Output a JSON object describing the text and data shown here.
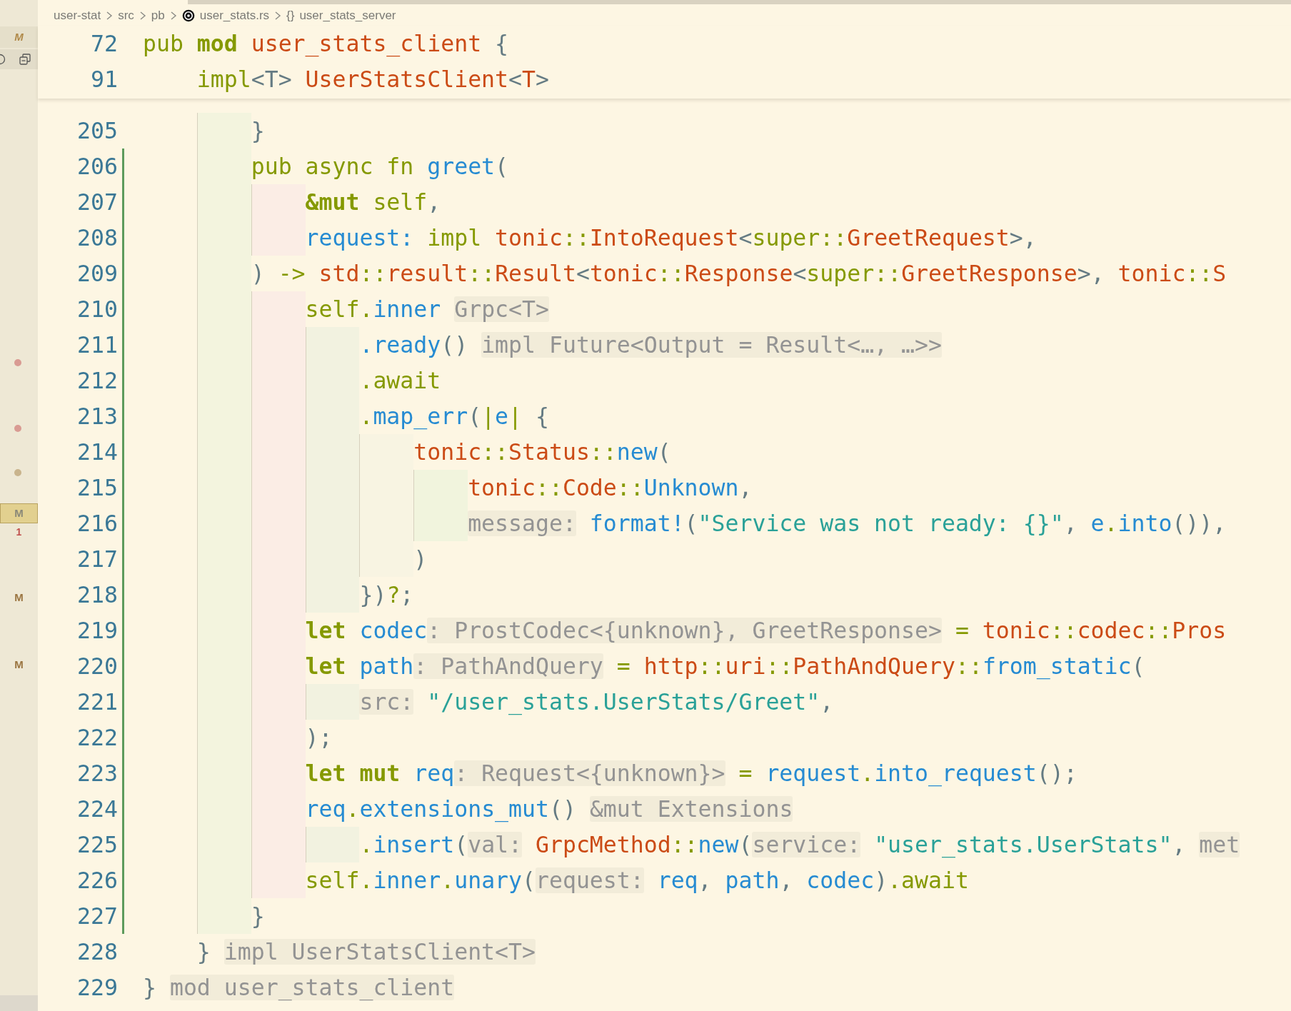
{
  "breadcrumb": [
    {
      "kind": "folder",
      "label": "user-stat"
    },
    {
      "kind": "folder",
      "label": "src"
    },
    {
      "kind": "folder",
      "label": "pb"
    },
    {
      "kind": "file",
      "label": "user_stats.rs"
    },
    {
      "kind": "module",
      "glyph": "{}",
      "label": "user_stats_server"
    }
  ],
  "side_strip": [
    {
      "kind": "heading-letter",
      "text": "M"
    },
    {
      "kind": "icons"
    },
    {
      "kind": "dot",
      "color": "#d99b93"
    },
    {
      "kind": "dot",
      "color": "#d99b93"
    },
    {
      "kind": "dot",
      "color": "#c9b48d"
    },
    {
      "kind": "letter",
      "text": "M",
      "selected": true
    },
    {
      "kind": "count",
      "text": "1"
    },
    {
      "kind": "letter",
      "text": "M",
      "selected": false
    },
    {
      "kind": "letter",
      "text": "M",
      "selected": false
    }
  ],
  "sticky_scroll": [
    {
      "number": "72",
      "tokens": [
        {
          "kind": "keyword",
          "text": "pub "
        },
        {
          "kind": "bold",
          "text": "mod "
        },
        {
          "kind": "type",
          "text": "user_stats_client"
        },
        {
          "kind": "punct",
          "text": " {"
        }
      ]
    },
    {
      "number": "91",
      "tokens": [
        {
          "kind": "keyword",
          "text": "    impl"
        },
        {
          "kind": "punct",
          "text": "<T> "
        },
        {
          "kind": "type",
          "text": "UserStatsClient"
        },
        {
          "kind": "punct",
          "text": "<"
        },
        {
          "kind": "type",
          "text": "T"
        },
        {
          "kind": "punct",
          "text": ">"
        }
      ]
    }
  ],
  "lines": [
    {
      "number": "205",
      "modified": false,
      "tokens": [
        {
          "kind": "punct",
          "text": "        }"
        }
      ]
    },
    {
      "number": "206",
      "modified": true,
      "tokens": [
        {
          "kind": "keyword",
          "text": "        pub async fn "
        },
        {
          "kind": "ident",
          "text": "greet"
        },
        {
          "kind": "punct",
          "text": "("
        }
      ]
    },
    {
      "number": "207",
      "modified": true,
      "tokens": [
        {
          "kind": "bold",
          "text": "            &mut "
        },
        {
          "kind": "keyword",
          "text": "self"
        },
        {
          "kind": "punct",
          "text": ","
        }
      ]
    },
    {
      "number": "208",
      "modified": true,
      "tokens": [
        {
          "kind": "ident",
          "text": "            request: "
        },
        {
          "kind": "keyword",
          "text": "impl "
        },
        {
          "kind": "type",
          "text": "tonic"
        },
        {
          "kind": "keyword",
          "text": "::"
        },
        {
          "kind": "type",
          "text": "IntoRequest"
        },
        {
          "kind": "punct",
          "text": "<"
        },
        {
          "kind": "keyword",
          "text": "super::"
        },
        {
          "kind": "type",
          "text": "GreetRequest"
        },
        {
          "kind": "punct",
          "text": ">,"
        }
      ]
    },
    {
      "number": "209",
      "modified": true,
      "tokens": [
        {
          "kind": "punct",
          "text": "        ) "
        },
        {
          "kind": "keyword",
          "text": "-> "
        },
        {
          "kind": "type",
          "text": "std"
        },
        {
          "kind": "keyword",
          "text": "::"
        },
        {
          "kind": "type",
          "text": "result"
        },
        {
          "kind": "keyword",
          "text": "::"
        },
        {
          "kind": "type",
          "text": "Result"
        },
        {
          "kind": "punct",
          "text": "<"
        },
        {
          "kind": "type",
          "text": "tonic"
        },
        {
          "kind": "keyword",
          "text": "::"
        },
        {
          "kind": "type",
          "text": "Response"
        },
        {
          "kind": "punct",
          "text": "<"
        },
        {
          "kind": "keyword",
          "text": "super::"
        },
        {
          "kind": "type",
          "text": "GreetResponse"
        },
        {
          "kind": "punct",
          "text": ">, "
        },
        {
          "kind": "type",
          "text": "tonic"
        },
        {
          "kind": "keyword",
          "text": "::"
        },
        {
          "kind": "type",
          "text": "S"
        }
      ]
    },
    {
      "number": "210",
      "modified": true,
      "tokens": [
        {
          "kind": "keyword",
          "text": "            self."
        },
        {
          "kind": "ident",
          "text": "inner "
        },
        {
          "kind": "hint",
          "text": "Grpc<T>"
        }
      ]
    },
    {
      "number": "211",
      "modified": true,
      "tokens": [
        {
          "kind": "ident",
          "text": "                .ready"
        },
        {
          "kind": "punct",
          "text": "() "
        },
        {
          "kind": "hint",
          "text": "impl Future<Output = Result<…, …>>"
        }
      ]
    },
    {
      "number": "212",
      "modified": true,
      "tokens": [
        {
          "kind": "keyword",
          "text": "                .await"
        }
      ]
    },
    {
      "number": "213",
      "modified": true,
      "tokens": [
        {
          "kind": "keyword",
          "text": "                ."
        },
        {
          "kind": "ident",
          "text": "map_err"
        },
        {
          "kind": "punct",
          "text": "("
        },
        {
          "kind": "keyword",
          "text": "|"
        },
        {
          "kind": "ident",
          "text": "e"
        },
        {
          "kind": "keyword",
          "text": "| "
        },
        {
          "kind": "punct",
          "text": "{"
        }
      ]
    },
    {
      "number": "214",
      "modified": true,
      "tokens": [
        {
          "kind": "type",
          "text": "                    tonic"
        },
        {
          "kind": "keyword",
          "text": "::"
        },
        {
          "kind": "type",
          "text": "Status"
        },
        {
          "kind": "keyword",
          "text": "::"
        },
        {
          "kind": "ident",
          "text": "new"
        },
        {
          "kind": "punct",
          "text": "("
        }
      ]
    },
    {
      "number": "215",
      "modified": true,
      "tokens": [
        {
          "kind": "type",
          "text": "                        tonic"
        },
        {
          "kind": "keyword",
          "text": "::"
        },
        {
          "kind": "type",
          "text": "Code"
        },
        {
          "kind": "keyword",
          "text": "::"
        },
        {
          "kind": "ident",
          "text": "Unknown"
        },
        {
          "kind": "punct",
          "text": ","
        }
      ]
    },
    {
      "number": "216",
      "modified": true,
      "tokens": [
        {
          "kind": "hint",
          "text": "                        message:"
        },
        {
          "kind": "ident",
          "text": " format!"
        },
        {
          "kind": "punct",
          "text": "("
        },
        {
          "kind": "string",
          "text": "\"Service was not ready: {}\""
        },
        {
          "kind": "punct",
          "text": ", "
        },
        {
          "kind": "ident",
          "text": "e"
        },
        {
          "kind": "keyword",
          "text": "."
        },
        {
          "kind": "ident",
          "text": "into"
        },
        {
          "kind": "punct",
          "text": "()),"
        }
      ]
    },
    {
      "number": "217",
      "modified": true,
      "tokens": [
        {
          "kind": "punct",
          "text": "                    )"
        }
      ]
    },
    {
      "number": "218",
      "modified": true,
      "tokens": [
        {
          "kind": "punct",
          "text": "                })"
        },
        {
          "kind": "keyword",
          "text": "?"
        },
        {
          "kind": "punct",
          "text": ";"
        }
      ]
    },
    {
      "number": "219",
      "modified": true,
      "tokens": [
        {
          "kind": "bold",
          "text": "            let "
        },
        {
          "kind": "ident",
          "text": "codec"
        },
        {
          "kind": "hint",
          "text": ": ProstCodec<{unknown}, GreetResponse>"
        },
        {
          "kind": "keyword",
          "text": " = "
        },
        {
          "kind": "type",
          "text": "tonic"
        },
        {
          "kind": "keyword",
          "text": "::"
        },
        {
          "kind": "type",
          "text": "codec"
        },
        {
          "kind": "keyword",
          "text": "::"
        },
        {
          "kind": "type",
          "text": "Pros"
        }
      ]
    },
    {
      "number": "220",
      "modified": true,
      "tokens": [
        {
          "kind": "bold",
          "text": "            let "
        },
        {
          "kind": "ident",
          "text": "path"
        },
        {
          "kind": "hint",
          "text": ": PathAndQuery"
        },
        {
          "kind": "keyword",
          "text": " = "
        },
        {
          "kind": "type",
          "text": "http"
        },
        {
          "kind": "keyword",
          "text": "::"
        },
        {
          "kind": "type",
          "text": "uri"
        },
        {
          "kind": "keyword",
          "text": "::"
        },
        {
          "kind": "type",
          "text": "PathAndQuery"
        },
        {
          "kind": "keyword",
          "text": "::"
        },
        {
          "kind": "ident",
          "text": "from_static"
        },
        {
          "kind": "punct",
          "text": "("
        }
      ]
    },
    {
      "number": "221",
      "modified": true,
      "tokens": [
        {
          "kind": "hint",
          "text": "                src:"
        },
        {
          "kind": "string",
          "text": " \"/user_stats.UserStats/Greet\""
        },
        {
          "kind": "punct",
          "text": ","
        }
      ]
    },
    {
      "number": "222",
      "modified": true,
      "tokens": [
        {
          "kind": "punct",
          "text": "            );"
        }
      ]
    },
    {
      "number": "223",
      "modified": true,
      "tokens": [
        {
          "kind": "bold",
          "text": "            let mut "
        },
        {
          "kind": "ident",
          "text": "req"
        },
        {
          "kind": "hint",
          "text": ": Request<{unknown}>"
        },
        {
          "kind": "keyword",
          "text": " = "
        },
        {
          "kind": "ident",
          "text": "request"
        },
        {
          "kind": "keyword",
          "text": "."
        },
        {
          "kind": "ident",
          "text": "into_request"
        },
        {
          "kind": "punct",
          "text": "();"
        }
      ]
    },
    {
      "number": "224",
      "modified": true,
      "tokens": [
        {
          "kind": "ident",
          "text": "            req"
        },
        {
          "kind": "keyword",
          "text": "."
        },
        {
          "kind": "ident",
          "text": "extensions_mut"
        },
        {
          "kind": "punct",
          "text": "() "
        },
        {
          "kind": "hint",
          "text": "&mut Extensions"
        }
      ]
    },
    {
      "number": "225",
      "modified": true,
      "tokens": [
        {
          "kind": "keyword",
          "text": "                ."
        },
        {
          "kind": "ident",
          "text": "insert"
        },
        {
          "kind": "punct",
          "text": "("
        },
        {
          "kind": "hint",
          "text": "val:"
        },
        {
          "kind": "type",
          "text": " GrpcMethod"
        },
        {
          "kind": "keyword",
          "text": "::"
        },
        {
          "kind": "ident",
          "text": "new"
        },
        {
          "kind": "punct",
          "text": "("
        },
        {
          "kind": "hint",
          "text": "service:"
        },
        {
          "kind": "string",
          "text": " \"user_stats.UserStats\""
        },
        {
          "kind": "punct",
          "text": ", "
        },
        {
          "kind": "hint",
          "text": "met"
        }
      ]
    },
    {
      "number": "226",
      "modified": true,
      "tokens": [
        {
          "kind": "keyword",
          "text": "            self."
        },
        {
          "kind": "ident",
          "text": "inner"
        },
        {
          "kind": "keyword",
          "text": "."
        },
        {
          "kind": "ident",
          "text": "unary"
        },
        {
          "kind": "punct",
          "text": "("
        },
        {
          "kind": "hint",
          "text": "request:"
        },
        {
          "kind": "ident",
          "text": " req"
        },
        {
          "kind": "punct",
          "text": ", "
        },
        {
          "kind": "ident",
          "text": "path"
        },
        {
          "kind": "punct",
          "text": ", "
        },
        {
          "kind": "ident",
          "text": "codec"
        },
        {
          "kind": "punct",
          "text": ")"
        },
        {
          "kind": "keyword",
          "text": ".await"
        }
      ]
    },
    {
      "number": "227",
      "modified": true,
      "tokens": [
        {
          "kind": "punct",
          "text": "        }"
        }
      ]
    },
    {
      "number": "228",
      "modified": false,
      "tokens": [
        {
          "kind": "punct",
          "text": "    } "
        },
        {
          "kind": "hint",
          "text": "impl UserStatsClient<T>"
        }
      ]
    },
    {
      "number": "229",
      "modified": false,
      "tokens": [
        {
          "kind": "punct",
          "text": "} "
        },
        {
          "kind": "hint",
          "text": "mod user_stats_client"
        }
      ]
    }
  ]
}
